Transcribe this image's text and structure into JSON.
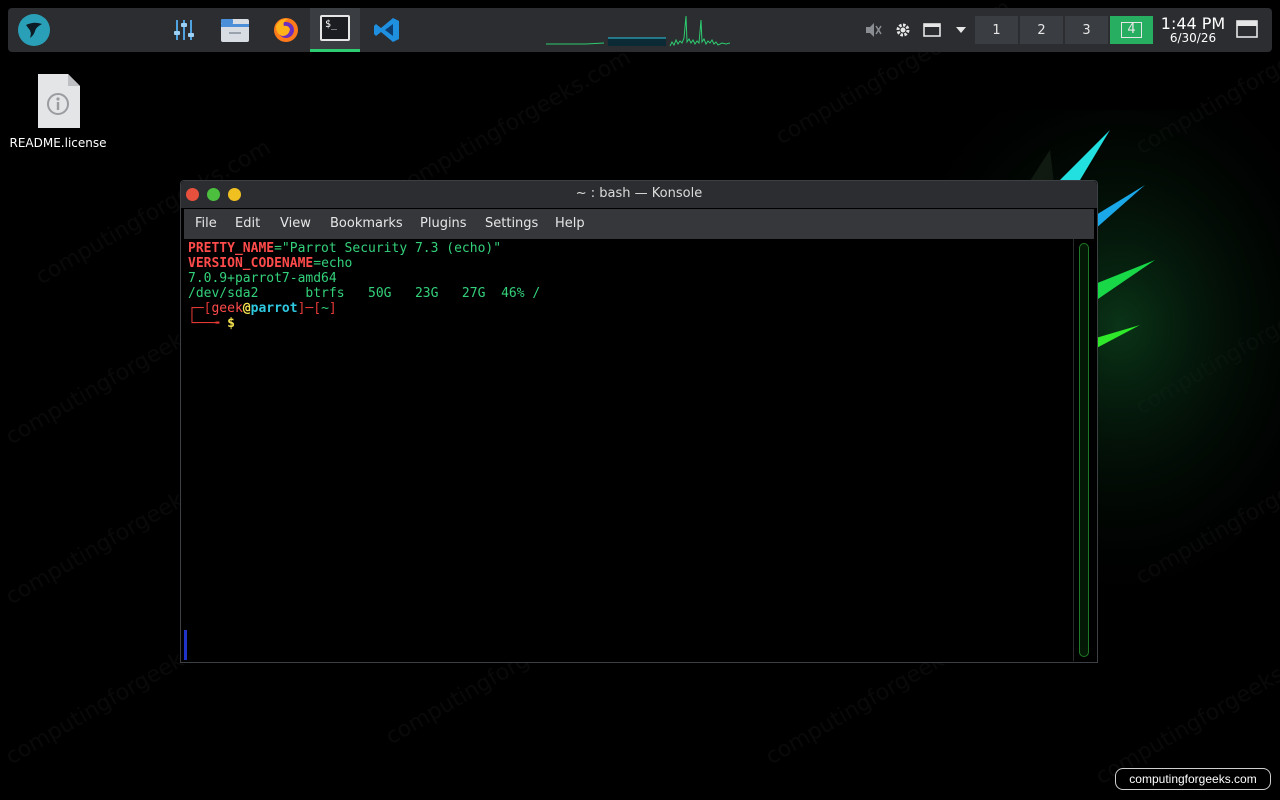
{
  "taskbar": {
    "launcher_icon": "parrot-logo-icon",
    "apps": [
      {
        "name": "settings-mixer-icon"
      },
      {
        "name": "file-manager-icon"
      },
      {
        "name": "firefox-icon"
      },
      {
        "name": "konsole-icon",
        "glyph": "$_"
      },
      {
        "name": "vscode-icon"
      }
    ],
    "tray": {
      "volume_icon": "speaker-muted-icon",
      "settings_icon": "gear-icon",
      "window_icon": "window-icon",
      "menu_icon": "triangle-down-icon"
    },
    "desktops": [
      {
        "label": "1",
        "active": false
      },
      {
        "label": "2",
        "active": false
      },
      {
        "label": "3",
        "active": false
      },
      {
        "label": "4",
        "active": true
      }
    ],
    "clock": {
      "time": "1:44 PM",
      "date": "6/30/26"
    },
    "accent_color": "#27ae60"
  },
  "desktop": {
    "icons": [
      {
        "label": "README.license",
        "icon": "info-document-icon"
      }
    ]
  },
  "window": {
    "title": "~ : bash — Konsole",
    "menu": [
      "File",
      "Edit",
      "View",
      "Bookmarks",
      "Plugins",
      "Settings",
      "Help"
    ]
  },
  "terminal": {
    "line1_key": "PRETTY_NAME",
    "line1_eq": "=",
    "line1_val": "\"Parrot Security 7.3 (echo)\"",
    "line2_key": "VERSION_CODENAME",
    "line2_eq": "=",
    "line2_val": "echo",
    "line3": "7.0.9+parrot7-amd64",
    "line4": "/dev/sda2      btrfs   50G   23G   27G  46% /",
    "prompt_open": "┌─[",
    "prompt_user": "geek",
    "prompt_at": "@",
    "prompt_host": "parrot",
    "prompt_mid": "]─[",
    "prompt_dir": "~",
    "prompt_close": "]",
    "prompt2_arrow": "└──╼ ",
    "prompt2_dollar": "$"
  },
  "watermark": {
    "text": "computingforgeeks.com",
    "badge": "computingforgeeks.com"
  }
}
